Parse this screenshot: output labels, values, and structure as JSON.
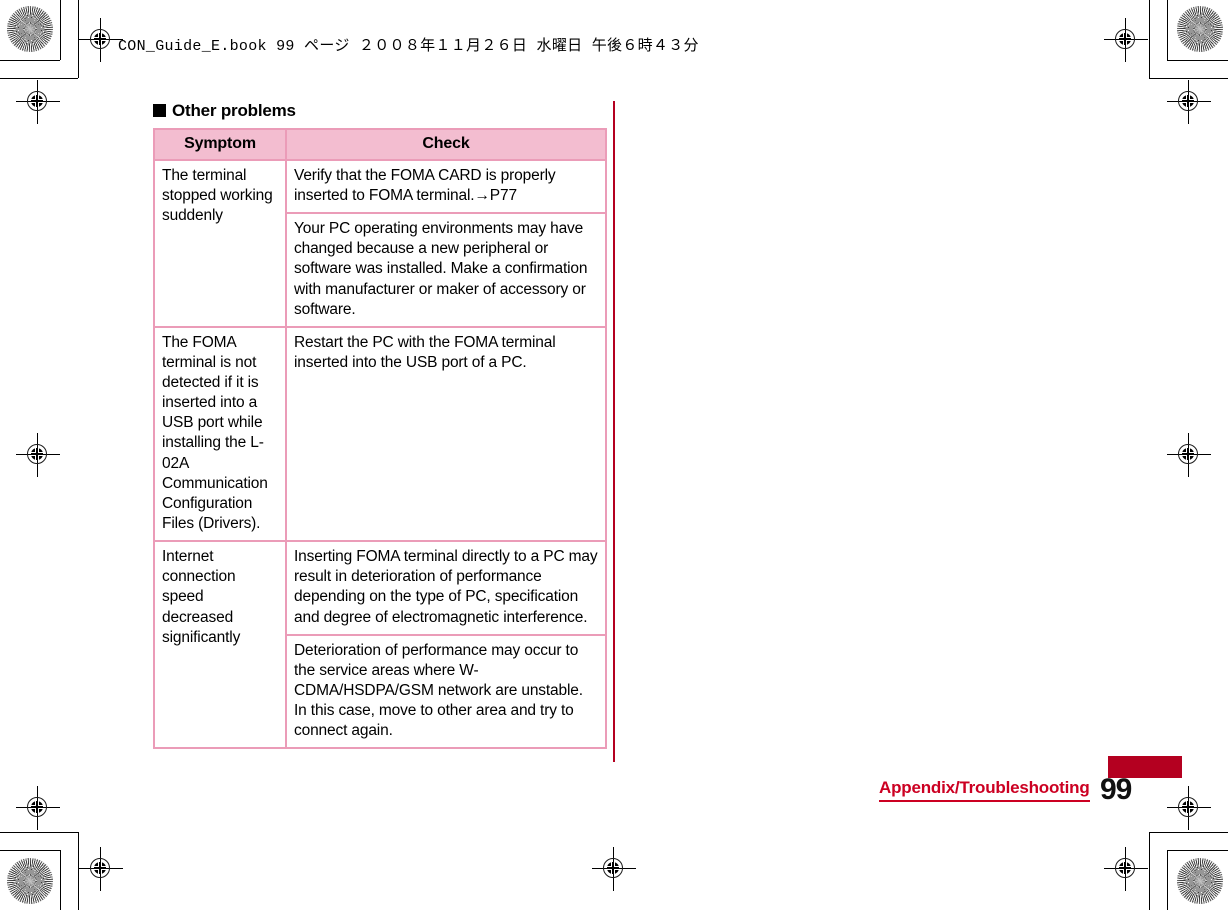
{
  "slug": {
    "text": "CON_Guide_E.book  99 ページ  ２００８年１１月２６日  水曜日  午後６時４３分"
  },
  "section": {
    "bullet": "filled-square",
    "heading": "Other problems"
  },
  "table": {
    "columns": [
      "Symptom",
      "Check"
    ],
    "rows": [
      {
        "symptom": "The terminal stopped working suddenly",
        "checks": [
          "Verify that the FOMA CARD is properly inserted to FOMA terminal.→P77",
          "Your PC operating environments may have changed because a new peripheral or software was installed. Make a confirmation with manufacturer or maker of accessory or software."
        ]
      },
      {
        "symptom": "The FOMA terminal is not detected if it is inserted into a USB port while installing the L-02A Communication Configuration Files (Drivers).",
        "checks": [
          "Restart the PC with the FOMA terminal inserted into the USB port of a PC."
        ]
      },
      {
        "symptom": "Internet connection speed decreased significantly",
        "checks": [
          "Inserting FOMA terminal directly to a PC may result in deterioration of performance depending on the type of PC, specification and degree of electromagnetic interference.",
          "Deterioration of performance may occur to the service areas where W-CDMA/HSDPA/GSM network are unstable. In this case, move to other area and try to connect again."
        ]
      }
    ]
  },
  "footer": {
    "chapter": "Appendix/Troubleshooting",
    "page_number": "99"
  },
  "colors": {
    "table_border": "#eb9cb8",
    "table_header_bg": "#f3bdd0",
    "accent_red": "#b40020",
    "chapter_red": "#cc0022"
  }
}
